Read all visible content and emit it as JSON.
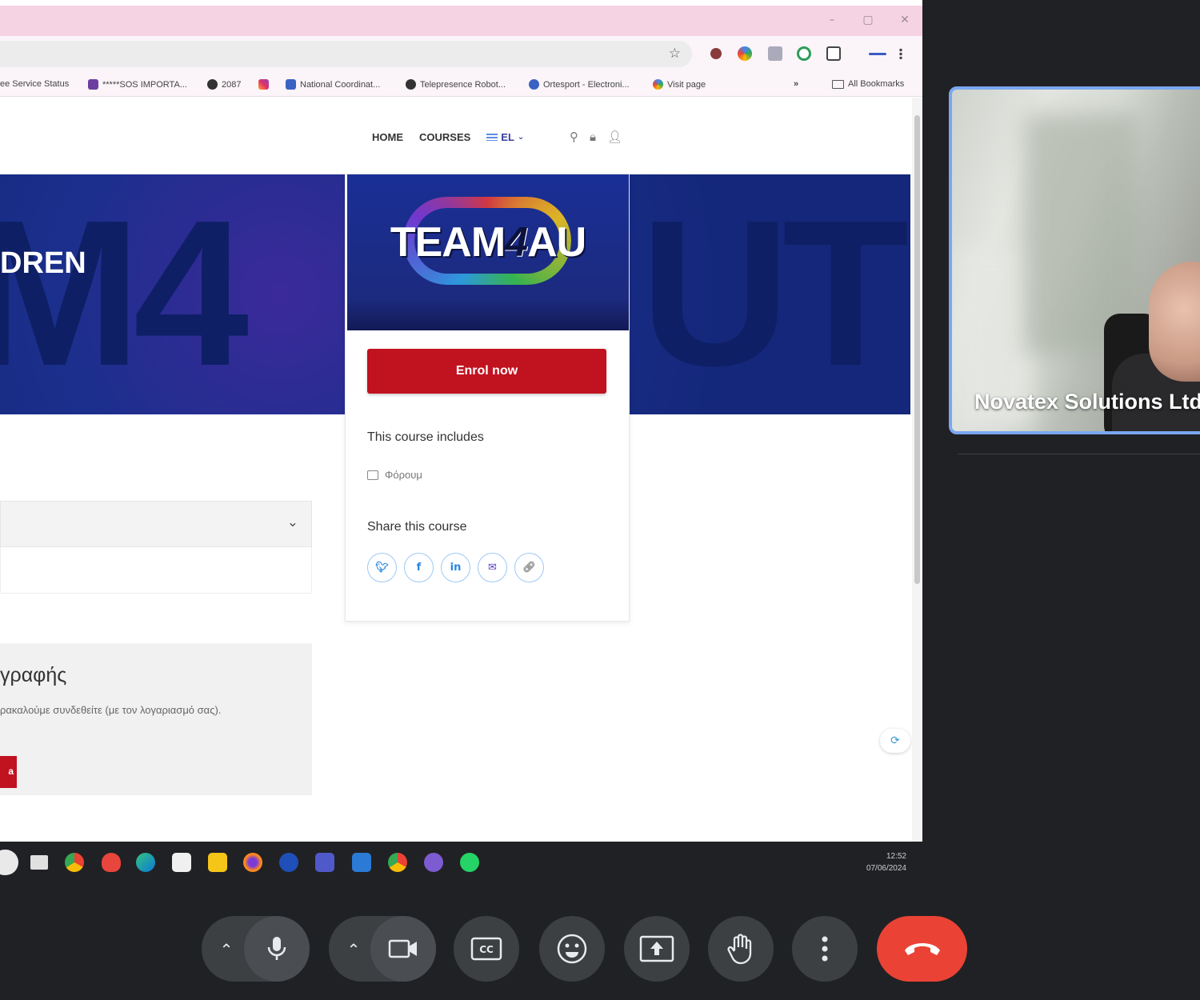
{
  "browser": {
    "bookmarks": [
      {
        "label": "ee Service Status",
        "color": "#00000000"
      },
      {
        "label": "*****SOS IMPORTA...",
        "color": "#6a3fa0"
      },
      {
        "label": "2087",
        "color": "#333333"
      },
      {
        "label": "",
        "color": "#e1306c"
      },
      {
        "label": "National Coordinat...",
        "color": "#3a62c4"
      },
      {
        "label": "Telepresence Robot...",
        "color": "#333333"
      },
      {
        "label": "Ortesport - Electroni...",
        "color": "#3a62c4"
      },
      {
        "label": "Visit page",
        "color": "#4285f4"
      }
    ],
    "overflow_chevron": "»",
    "all_bookmarks": "All Bookmarks"
  },
  "site": {
    "nav": {
      "home": "HOME",
      "courses": "COURSES",
      "lang": "EL"
    },
    "hero_title": "DREN",
    "hero_bg_left": "M4",
    "hero_bg_right": "UT",
    "course_logo": {
      "pre": "TEAM",
      "four": "4",
      "post": "AU"
    },
    "enrol_button": "Enrol now",
    "includes_heading": "This course includes",
    "includes_item": "Φόρουμ",
    "share_heading": "Share this course",
    "share_icons": [
      "twitter-icon",
      "facebook-icon",
      "linkedin-icon",
      "email-icon",
      "link-icon"
    ],
    "enrol_box_title": "γραφής",
    "enrol_box_text": "ρακαλούμε συνδεθείτε (με τον λογαριασμό σας).",
    "enrol_box_button": "a"
  },
  "taskbar": {
    "time": "12:52",
    "date": "07/06/2024"
  },
  "meeting": {
    "participant_name": "Novatex Solutions Ltd",
    "controls": [
      "microphone-icon",
      "camera-icon",
      "captions-icon",
      "emoji-icon",
      "present-icon",
      "raise-hand-icon",
      "more-options-icon",
      "hang-up-icon"
    ],
    "colors": {
      "hangup": "#ea4335",
      "control": "#3c4043",
      "tile_border": "#7aa7f0"
    }
  }
}
